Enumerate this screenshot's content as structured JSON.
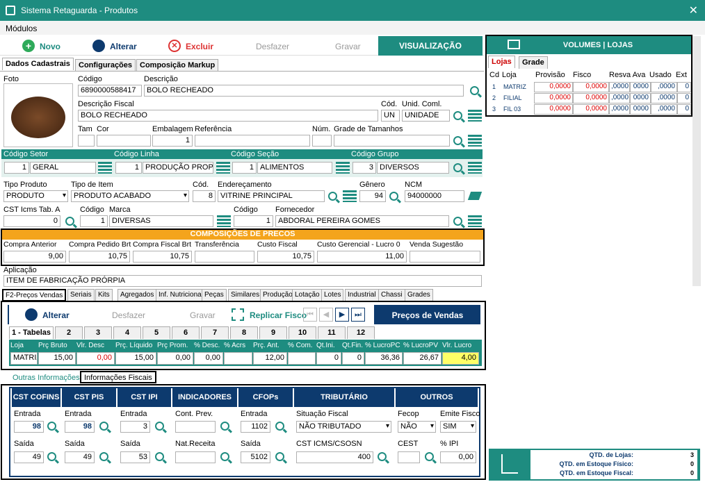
{
  "window": {
    "title": "Sistema Retaguarda - Produtos",
    "close": "✕"
  },
  "menu": {
    "modulos": "Módulos"
  },
  "toolbar": {
    "novo": "Novo",
    "alterar": "Alterar",
    "excluir": "Excluir",
    "desfazer": "Desfazer",
    "gravar": "Gravar",
    "visualizacao": "VISUALIZAÇÃO"
  },
  "tabs": {
    "dados": "Dados Cadastrais",
    "config": "Configurações",
    "markup": "Composição Markup"
  },
  "labels": {
    "foto": "Foto",
    "codigo": "Código",
    "descricao": "Descrição",
    "desc_fiscal": "Descrição Fiscal",
    "cod": "Cód.",
    "unid": "Unid. Coml.",
    "tam": "Tam",
    "cor": "Cor",
    "embalagem": "Embalagem",
    "referencia": "Referência",
    "num": "Núm.",
    "grade_tam": "Grade de Tamanhos",
    "cod_setor": "Código  Setor",
    "cod_linha": "Código  Linha",
    "cod_secao": "Código  Seção",
    "cod_grupo": "Código  Grupo",
    "tipo_produto": "Tipo Produto",
    "tipo_item": "Tipo de Item",
    "cod2": "Cód.",
    "enderecamento": "Endereçamento",
    "genero": "Gênero",
    "ncm": "NCM",
    "cst_icms": "CST Icms Tab. A",
    "codigo2": "Código",
    "marca": "Marca",
    "codigo3": "Código",
    "fornecedor": "Fornecedor",
    "aplicacao": "Aplicação"
  },
  "produto": {
    "codigo": "6890000588417",
    "descricao": "BOLO RECHEADO",
    "desc_fiscal": "BOLO RECHEADO",
    "unid_cod": "UN",
    "unid": "UNIDADE",
    "embalagem": "1",
    "setor_cod": "1",
    "setor": "GERAL",
    "linha_cod": "1",
    "linha": "PRODUÇÃO PROPRIA",
    "secao_cod": "1",
    "secao": "ALIMENTOS",
    "grupo_cod": "3",
    "grupo": "DIVERSOS",
    "tipo_produto": "PRODUTO",
    "tipo_item": "PRODUTO ACABADO",
    "end_cod": "8",
    "enderecamento": "VITRINE PRINCIPAL",
    "genero": "94",
    "ncm": "94000000",
    "cst": "0",
    "marca_cod": "1",
    "marca": "DIVERSAS",
    "forn_cod": "1",
    "fornecedor": "ABDORAL PEREIRA GOMES",
    "aplicacao": "ITEM DE FABRICAÇÃO PRÓRPIA"
  },
  "precos": {
    "title": "COMPOSIÇÕES DE PRECOS",
    "labels": [
      "Compra Anterior",
      "Compra Pedido Brt",
      "Compra Fiscal Brt",
      "Transferência",
      "Custo Fiscal",
      "Custo Gerencial - Lucro 0",
      "Venda Sugestão"
    ],
    "values": [
      "9,00",
      "10,75",
      "10,75",
      "",
      "10,75",
      "11,00",
      ""
    ]
  },
  "subtabs": [
    "F2-Preços Vendas",
    "Seriais",
    "Kits",
    "Agregados",
    "Inf. Nutricional",
    "Peças",
    "Similares",
    "Produção",
    "Lotação",
    "Lotes",
    "Industrial",
    "Chassi",
    "Grades"
  ],
  "vendas": {
    "alterar": "Alterar",
    "desfazer": "Desfazer",
    "gravar": "Gravar",
    "replicar": "Replicar Fisco",
    "title": "Preços de Vendas",
    "tabelas": [
      "1 - Tabelas",
      "2",
      "3",
      "4",
      "5",
      "6",
      "7",
      "8",
      "9",
      "10",
      "11",
      "12"
    ],
    "cols": [
      "Loja",
      "Prç Bruto",
      "Vlr. Desc",
      "Prç. Líquido",
      "Prç Prom.",
      "% Desc.",
      "% Acrs",
      "Prç. Ant.",
      "% Com.",
      "Qt.Ini.",
      "Qt.Fin.",
      "% LucroPC",
      "% LucroPV",
      "Vlr. Lucro"
    ],
    "row": [
      "MATRIZ",
      "15,00",
      "0,00",
      "15,00",
      "0,00",
      "0,00",
      "",
      "12,00",
      "",
      "0",
      "0",
      "36,36",
      "26,67",
      "4,00"
    ]
  },
  "infotabs": {
    "outras": "Outras Informações",
    "fiscais": "Informações Fiscais"
  },
  "fiscal": {
    "headers": [
      "CST COFINS",
      "CST PIS",
      "CST IPI",
      "INDICADORES",
      "CFOPs",
      "TRIBUTÁRIO",
      "OUTROS"
    ],
    "entrada": "Entrada",
    "saida": "Saída",
    "cofins_e": "98",
    "cofins_s": "49",
    "pis_e": "98",
    "pis_s": "49",
    "ipi_e": "3",
    "ipi_s": "53",
    "cont_prev": "Cont. Prev.",
    "nat_receita": "Nat.Receita",
    "cfop_e": "1102",
    "cfop_s": "5102",
    "sit_fiscal": "Situação Fiscal",
    "sit_val": "NÃO TRIBUTADO",
    "cst_csosn": "CST ICMS/CSOSN",
    "cst_val": "400",
    "fecop": "Fecop",
    "fecop_val": "NÃO",
    "emite": "Emite Fisco",
    "emite_val": "SIM",
    "cest": "CEST",
    "ipi_pct": "% IPI",
    "ipi_val": "0,00"
  },
  "volumes": {
    "title": "VOLUMES | LOJAS",
    "tab_lojas": "Lojas",
    "tab_grade": "Grade",
    "cols": [
      "Cd",
      "Loja",
      "Provisão",
      "Fisco",
      "Resva Ava",
      "Usado",
      "Ext"
    ],
    "rows": [
      [
        "1",
        "MATRIZ",
        "0,0000",
        "0,0000",
        ",0000",
        "0000",
        ",0000",
        "0"
      ],
      [
        "2",
        "FILIAL",
        "0,0000",
        "0,0000",
        ",0000",
        "0000",
        ",0000",
        "0"
      ],
      [
        "3",
        "FIL 03",
        "0,0000",
        "0,0000",
        ",0000",
        "0000",
        ",0000",
        "0"
      ]
    ]
  },
  "summary": {
    "qtd_lojas": "QTD. de Lojas:",
    "qtd_lojas_v": "3",
    "est_fisico": "QTD. em Estoque Físico:",
    "est_fisico_v": "0",
    "est_fisico2": "QTD. em Estoque Fiscal:",
    "est_fisico2_v": "0"
  },
  "colors": {
    "teal": "#1e8c80",
    "navy": "#0d3a6e",
    "orange": "#f4a41c"
  }
}
